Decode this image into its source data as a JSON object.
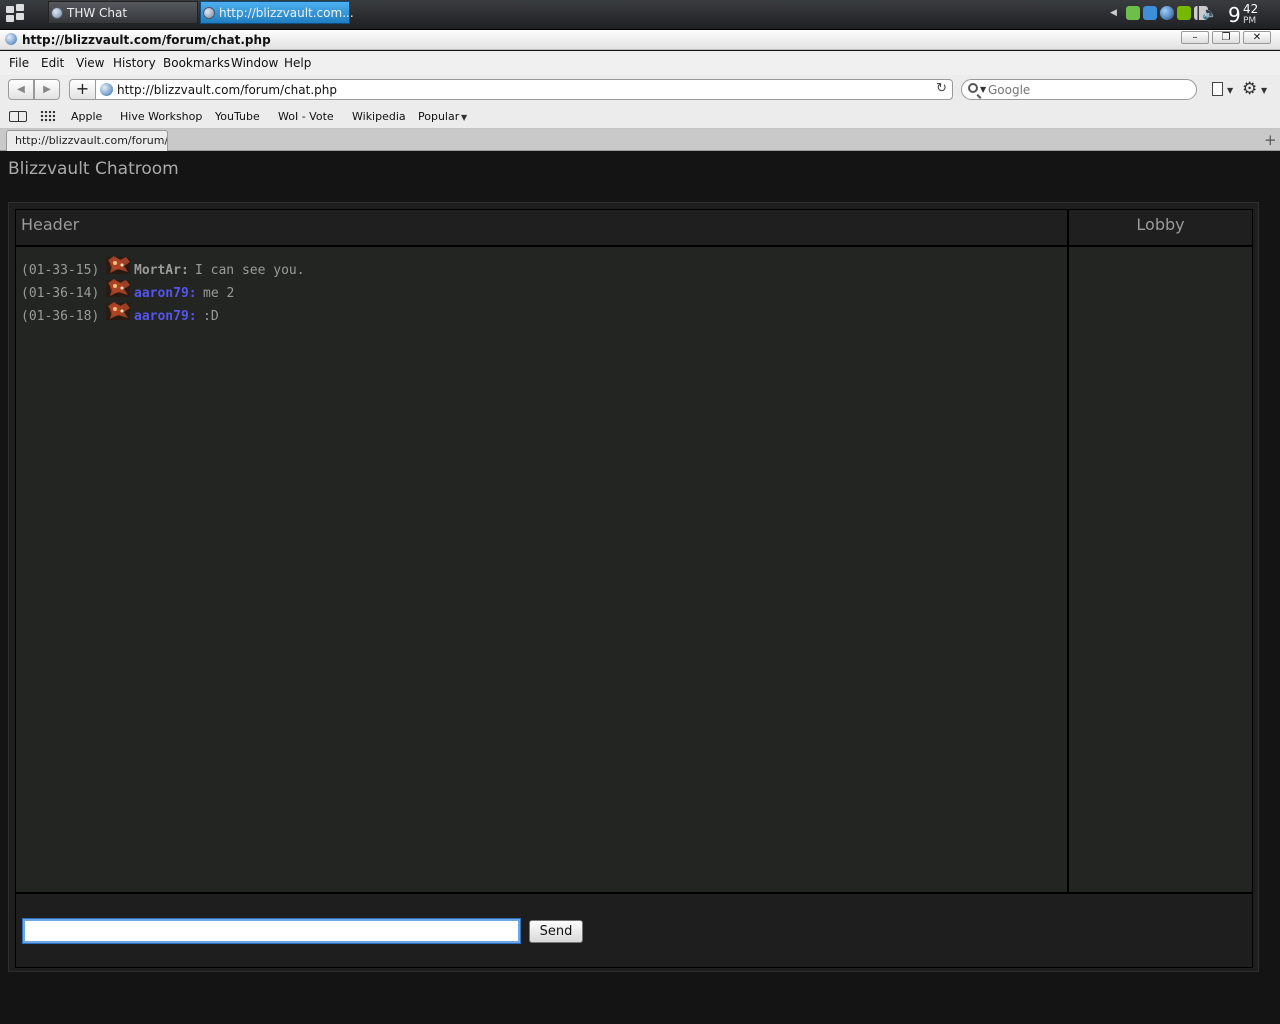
{
  "taskbar": {
    "tasks": [
      {
        "label": "THW Chat"
      },
      {
        "label": "http://blizzvault.com..."
      }
    ],
    "clock": {
      "hour": "9",
      "minutes": "42",
      "ampm": "PM"
    }
  },
  "window": {
    "title": "http://blizzvault.com/forum/chat.php"
  },
  "menu": {
    "items": [
      "File",
      "Edit",
      "View",
      "History",
      "Bookmarks",
      "Window",
      "Help"
    ]
  },
  "toolbar": {
    "add_label": "+",
    "url": "http://blizzvault.com/forum/chat.php",
    "search_placeholder": "Google"
  },
  "bookmarks": {
    "items": [
      "Apple",
      "Hive Workshop",
      "YouTube",
      "WoI - Vote",
      "Wikipedia",
      "Popular"
    ]
  },
  "tabs": [
    {
      "label": "http://blizzvault.com/forum/..."
    }
  ],
  "page": {
    "title": "Blizzvault Chatroom",
    "header_label": "Header",
    "lobby_label": "Lobby",
    "messages": [
      {
        "time": "(01-33-15)",
        "user": "MortAr:",
        "text": "I can see you.",
        "user_color": "#9a9a9a"
      },
      {
        "time": "(01-36-14)",
        "user": "aaron79:",
        "text": "me 2",
        "user_color": "#5555ee"
      },
      {
        "time": "(01-36-18)",
        "user": "aaron79:",
        "text": ":D",
        "user_color": "#5555ee"
      }
    ],
    "input_value": "",
    "send_label": "Send"
  },
  "colors": {
    "background": "#141414",
    "panel": "#232522",
    "text_muted": "#9a9a9a",
    "user_link": "#5555ee",
    "focus_ring": "#6fa6e6"
  }
}
